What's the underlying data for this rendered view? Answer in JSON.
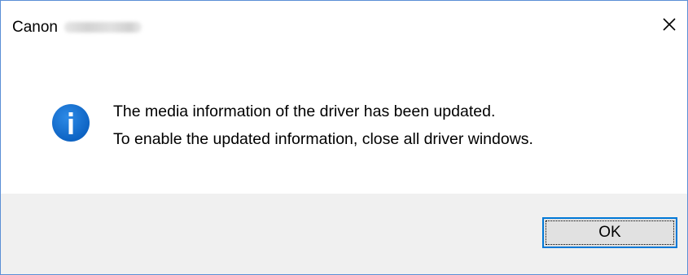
{
  "window": {
    "title": "Canon",
    "title_suffix_redacted": true,
    "close_icon": "close-icon",
    "border_color": "#5b8fd6"
  },
  "message": {
    "icon": "info-icon",
    "icon_color": "#0a6ed1",
    "line1": "The media information of the driver has been updated.",
    "line2": "To enable the updated information, close all driver windows."
  },
  "buttons": {
    "ok_label": "OK",
    "ok_focus_color": "#0078d7"
  }
}
